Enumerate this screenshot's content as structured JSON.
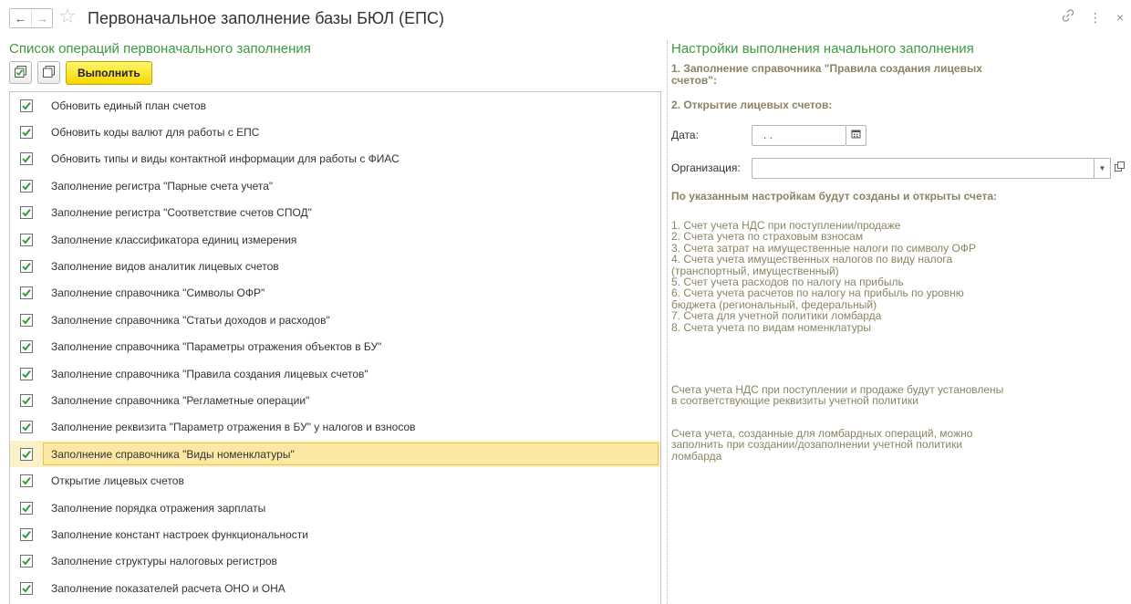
{
  "window": {
    "title": "Первоначальное заполнение базы БЮЛ (ЕПС)",
    "back_icon": "←",
    "forward_icon": "→",
    "star_icon": "☆",
    "link_icon": "🔗",
    "more_icon": "⋮",
    "close_icon": "×"
  },
  "left": {
    "title": "Список операций первоначального заполнения",
    "execute_label": "Выполнить",
    "items": [
      {
        "label": "Обновить единый план счетов",
        "checked": true
      },
      {
        "label": "Обновить коды валют для работы с ЕПС",
        "checked": true
      },
      {
        "label": "Обновить типы и виды контактной информации для работы с ФИАС",
        "checked": true
      },
      {
        "label": "Заполнение регистра \"Парные счета учета\"",
        "checked": true
      },
      {
        "label": "Заполнение регистра \"Соответствие счетов СПОД\"",
        "checked": true
      },
      {
        "label": "Заполнение классификатора единиц измерения",
        "checked": true
      },
      {
        "label": "Заполнение видов аналитик лицевых счетов",
        "checked": true
      },
      {
        "label": "Заполнение справочника \"Символы ОФР\"",
        "checked": true
      },
      {
        "label": "Заполнение справочника \"Статьи доходов и расходов\"",
        "checked": true
      },
      {
        "label": "Заполнение справочника \"Параметры отражения объектов в БУ\"",
        "checked": true
      },
      {
        "label": "Заполнение справочника \"Правила создания лицевых счетов\"",
        "checked": true
      },
      {
        "label": "Заполнение справочника \"Регламетные операции\"",
        "checked": true
      },
      {
        "label": "Заполнение реквизита \"Параметр отражения в БУ\" у налогов и взносов",
        "checked": true
      },
      {
        "label": "Заполнение справочника \"Виды номенклатуры\"",
        "checked": true,
        "selected": true
      },
      {
        "label": "Открытие лицевых счетов",
        "checked": true
      },
      {
        "label": "Заполнение порядка отражения зарплаты",
        "checked": true
      },
      {
        "label": "Заполнение констант настроек функциональности",
        "checked": true
      },
      {
        "label": "Заполнение структуры налоговых регистров",
        "checked": true
      },
      {
        "label": "Заполнение показателей расчета ОНО и ОНА",
        "checked": true
      }
    ]
  },
  "right": {
    "title": "Настройки выполнения начального заполнения",
    "section1_line1": "1. Заполнение справочника \"Правила создания лицевых",
    "section1_line2": "счетов\":",
    "section2": "2. Открытие лицевых счетов:",
    "date_label": "Дата:",
    "date_value": " .  .",
    "org_label": "Организация:",
    "org_value": "",
    "accounts_heading": "По указанным настройкам будут созданы и открыты счета:",
    "accounts_list": [
      "1. Счет учета НДС при поступлении/продаже",
      "2. Счета учета по страховым взносам",
      "3. Счета затрат на имущественные налоги по символу ОФР",
      "4. Счета учета имущественных налогов по виду налога",
      "(транспортный, имущественный)",
      "5. Счет учета расходов по налогу на прибыль",
      "6. Счета учета расчетов по налогу на прибыль по уровню",
      "бюджета (региональный, федеральный)",
      "7. Счета для учетной политики ломбарда",
      "8. Счета учета по видам номенклатуры"
    ],
    "note1": [
      "Счета учета НДС при поступлении и продаже будут установлены",
      "в соответствующие реквизиты учетной политики"
    ],
    "note2": [
      "Счета учета, созданные для ломбардных операций, можно",
      "заполнить при создании/дозаполнении учетной политики",
      "ломбарда"
    ]
  }
}
